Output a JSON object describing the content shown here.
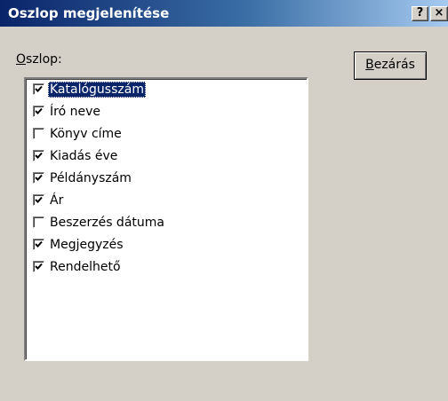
{
  "window": {
    "title": "Oszlop megjelenítése",
    "help_button": "?",
    "close_button": "×"
  },
  "column_label": {
    "accel": "O",
    "rest": "szlop:"
  },
  "close_dialog_button": {
    "accel": "B",
    "rest": "ezárás"
  },
  "columns": [
    {
      "label": "Katalógusszám",
      "checked": true,
      "selected": true
    },
    {
      "label": "Író neve",
      "checked": true,
      "selected": false
    },
    {
      "label": "Könyv címe",
      "checked": false,
      "selected": false
    },
    {
      "label": "Kiadás éve",
      "checked": true,
      "selected": false
    },
    {
      "label": "Példányszám",
      "checked": true,
      "selected": false
    },
    {
      "label": "Ár",
      "checked": true,
      "selected": false
    },
    {
      "label": "Beszerzés dátuma",
      "checked": false,
      "selected": false
    },
    {
      "label": "Megjegyzés",
      "checked": true,
      "selected": false
    },
    {
      "label": "Rendelhető",
      "checked": true,
      "selected": false
    }
  ]
}
